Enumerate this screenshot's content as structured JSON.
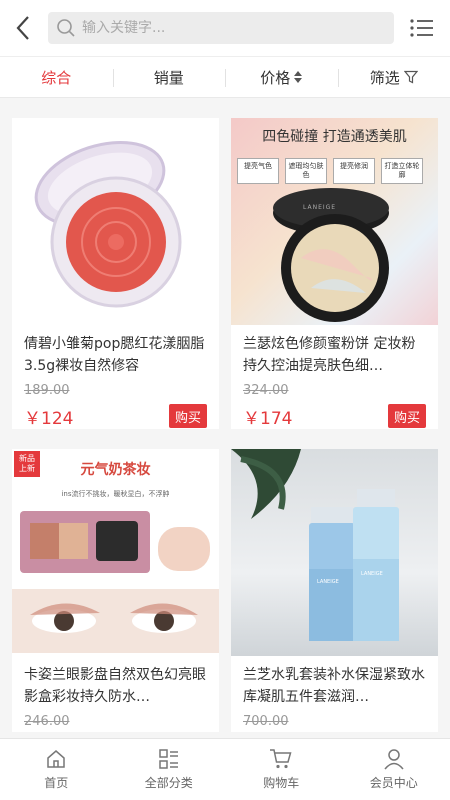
{
  "search": {
    "placeholder": "输入关键字..."
  },
  "filters": [
    {
      "label": "综合",
      "active": true
    },
    {
      "label": "销量",
      "active": false
    },
    {
      "label": "价格",
      "active": false
    },
    {
      "label": "筛选",
      "active": false
    }
  ],
  "products": [
    {
      "title": "倩碧小雏菊pop腮红花漾胭脂3.5g裸妆自然修容",
      "old_price": "189.00",
      "price": "￥124",
      "buy_label": "购买"
    },
    {
      "title": "兰瑟炫色修颜蜜粉饼 定妆粉持久控油提亮肤色细…",
      "old_price": "324.00",
      "price": "￥174",
      "buy_label": "购买",
      "banner": "四色碰撞 打造通透美肌",
      "tags": [
        "提亮气色",
        "遮瑕均匀肤色",
        "提亮修润",
        "打造立体轮廓"
      ],
      "brand": "LANEIGE"
    },
    {
      "title": "卡姿兰眼影盘自然双色幻亮眼影盒彩妆持久防水…",
      "old_price": "246.00",
      "price": "",
      "buy_label": "",
      "badge": "新品上新",
      "banner": "元气奶茶妆",
      "sub_banner": "ins流行不挑妆，暖秋显白，不浮肿"
    },
    {
      "title": "兰芝水乳套装补水保湿紧致水库凝肌五件套滋润…",
      "old_price": "700.00",
      "price": "",
      "buy_label": "",
      "brand": "LANEIGE"
    }
  ],
  "tabbar": [
    {
      "label": "首页",
      "icon": "home-icon"
    },
    {
      "label": "全部分类",
      "icon": "category-icon"
    },
    {
      "label": "购物车",
      "icon": "cart-icon"
    },
    {
      "label": "会员中心",
      "icon": "user-icon"
    }
  ],
  "colors": {
    "accent": "#e4393c",
    "background": "#f5f5f5"
  }
}
